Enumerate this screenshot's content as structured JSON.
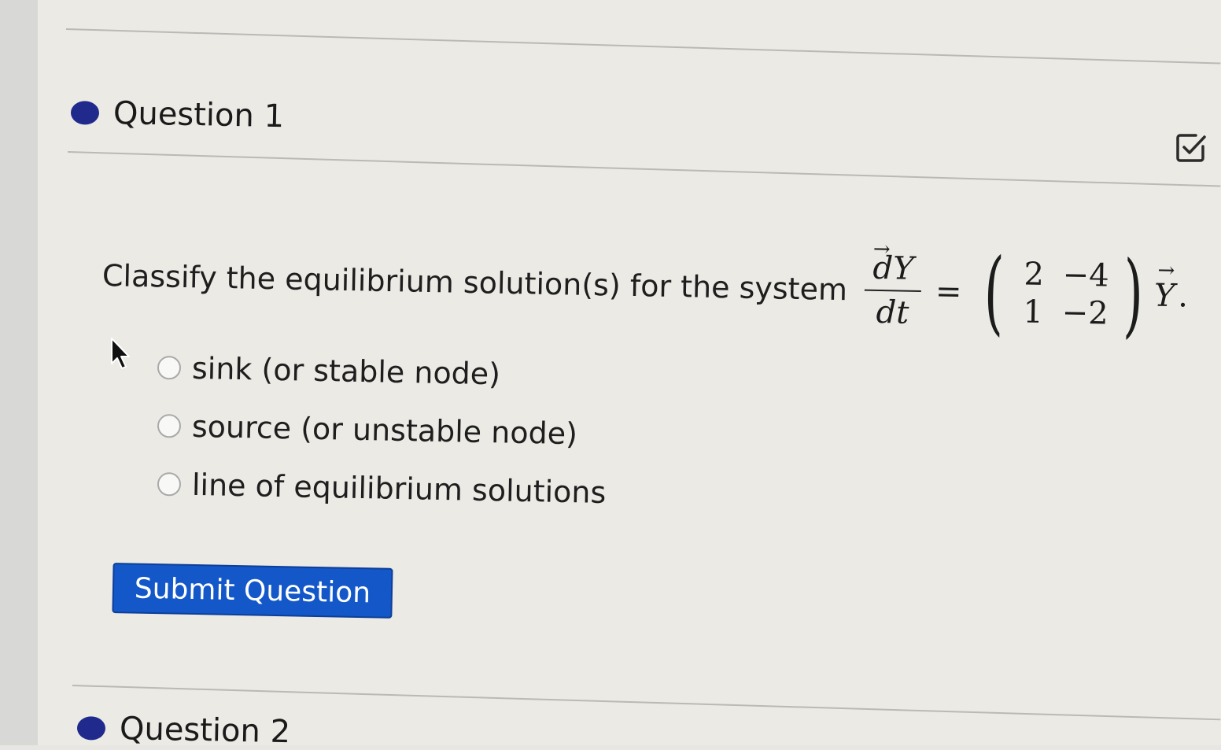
{
  "question1": {
    "title": "Question 1",
    "prompt": "Classify the equilibrium solution(s) for the system",
    "equation": {
      "numerator": "dY",
      "denominator": "dt",
      "equals": "=",
      "matrix": [
        "2",
        "−4",
        "1",
        "−2"
      ],
      "vector": "Y",
      "period": "."
    },
    "options": [
      {
        "label": "sink (or stable node)",
        "selected": false
      },
      {
        "label": "source (or unstable node)",
        "selected": false
      },
      {
        "label": "line of equilibrium solutions",
        "selected": false
      }
    ],
    "submit_label": "Submit Question"
  },
  "question2": {
    "title": "Question 2"
  },
  "colors": {
    "question_dot": "#1f2a8c",
    "submit_button": "#1357c8"
  },
  "icons": {
    "edit": "edit-checkbox-icon",
    "cursor": "mouse-pointer-icon"
  }
}
